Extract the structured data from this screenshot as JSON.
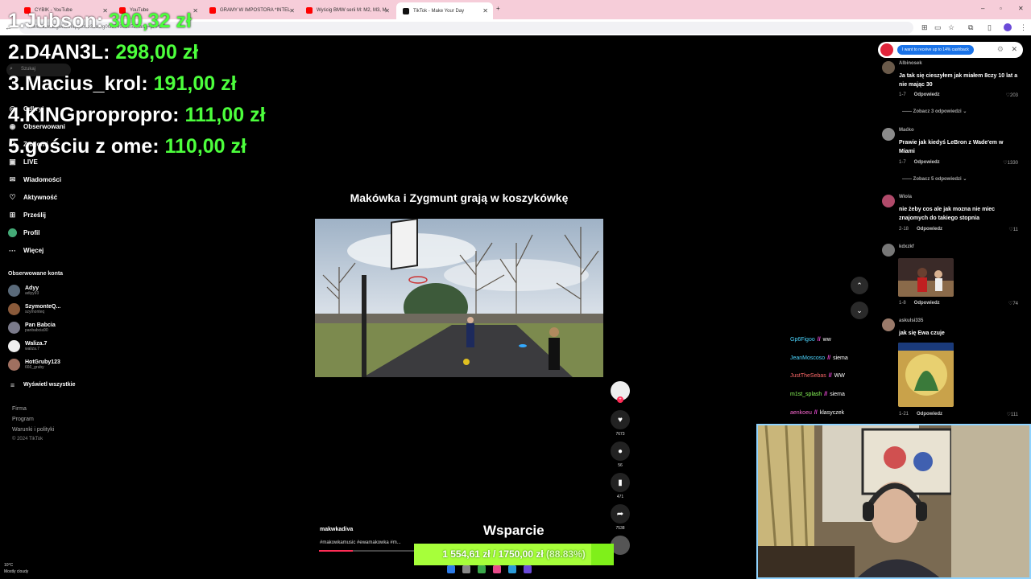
{
  "browser": {
    "tabs": [
      {
        "label": "CYBIK - YouTube",
        "color": "#ff0000"
      },
      {
        "label": "YouTube",
        "color": "#ff0000"
      },
      {
        "label": "GRAMY W IMPOSTORA *INTEL",
        "color": "#ff0000"
      },
      {
        "label": "Wyścig BMW serii M: M2, M3, M",
        "color": "#ff0000"
      },
      {
        "label": "TikTok - Make Your Day",
        "color": "#111111"
      }
    ],
    "url": "...skwhkuwaligwlawhiqaj3c0e3ua0rg0G97490L653?lang=pl-PL"
  },
  "leaderboard": [
    {
      "rank": "1.",
      "name": "Jubson:",
      "amount": "300,32 zł"
    },
    {
      "rank": "2.",
      "name": "D4AN3L:",
      "amount": "298,00 zł"
    },
    {
      "rank": "3.",
      "name": "Macius_krol:",
      "amount": "191,00 zł"
    },
    {
      "rank": "4.",
      "name": "KINGpropropro:",
      "amount": "111,00 zł"
    },
    {
      "rank": "5.",
      "name": "gościu z ome:",
      "amount": "110,00 zł"
    }
  ],
  "sidebar": {
    "search_placeholder": "Szukaj",
    "items": [
      {
        "label": "Odkryj",
        "icon": "compass-icon"
      },
      {
        "label": "Obserwowani",
        "icon": "following-icon"
      },
      {
        "label": "Znajomi",
        "icon": "friends-icon"
      },
      {
        "label": "LIVE",
        "icon": "live-icon"
      },
      {
        "label": "Wiadomości",
        "icon": "message-icon"
      },
      {
        "label": "Aktywność",
        "icon": "activity-icon"
      },
      {
        "label": "Prześlij",
        "icon": "upload-icon"
      },
      {
        "label": "Profil",
        "icon": "profile-icon"
      },
      {
        "label": "Więcej",
        "icon": "more-icon"
      }
    ],
    "followed_header": "Obserwowane konta",
    "followed": [
      {
        "name": "Adyy",
        "handle": "adiyy93"
      },
      {
        "name": "SzymonteQ...",
        "handle": "szymonteq"
      },
      {
        "name": "Pan Babcia",
        "handle": "panbabcia90"
      },
      {
        "name": "Waliza.7",
        "handle": "waliza.7"
      },
      {
        "name": "HotGruby123",
        "handle": "666_gruby"
      }
    ],
    "show_all": "Wyświetl wszystkie",
    "footer": [
      "Firma",
      "Program",
      "Warunki i polityki",
      "© 2024 TikTok"
    ]
  },
  "video": {
    "title": "Makówka i Zygmunt grają w koszykówkę",
    "creator": "makwkadiva",
    "tags": "#makowkamusic #ewamakowka #m...",
    "likes": "7673",
    "comments": "56",
    "saves": "471",
    "shares": "7538"
  },
  "goal": {
    "heading": "Wsparcie",
    "current": "1 554,61 zł",
    "separator": "/",
    "target": "1750,00 zł",
    "percent": "(88.83%)",
    "fraction": 0.8883
  },
  "chat": [
    {
      "user": "Gp6Figoo",
      "msg": "ww"
    },
    {
      "user": "JeanMoscoso",
      "msg": "siema"
    },
    {
      "user": "JustTheSebas",
      "msg": "WW"
    },
    {
      "user": "m1st_splash",
      "msg": "siema"
    },
    {
      "user": "aenkoeu",
      "msg": "klasyczek"
    }
  ],
  "cashback": "I want to receive up to 14% cashback",
  "comments": [
    {
      "user": "Albinosek",
      "text": "Ja tak się cieszyłem jak miałem 8czy 10 lat a nie mając 30",
      "date": "1-7",
      "reply": "Odpowiedz",
      "likes": "203",
      "more": "Zobacz 3 odpowiedzi"
    },
    {
      "user": "Maćko",
      "text": "Prawie jak kiedyś LeBron z Wade'em w Miami",
      "date": "1-7",
      "reply": "Odpowiedz",
      "likes": "1330",
      "more": "Zobacz 5 odpowiedzi"
    },
    {
      "user": "Wiola",
      "text": "nie żeby cos ale jak mozna nie miec znajomych do takiego stopnia",
      "date": "2-18",
      "reply": "Odpowiedz",
      "likes": "11"
    },
    {
      "user": "kdxzkf",
      "text": "",
      "date": "1-8",
      "reply": "Odpowiedz",
      "likes": "74"
    },
    {
      "user": "askulsi335",
      "text": "jak się Ewa czuje",
      "date": "1-21",
      "reply": "Odpowiedz",
      "likes": "111"
    }
  ],
  "weather": {
    "temp": "10°C",
    "desc": "Mostly cloudy"
  }
}
